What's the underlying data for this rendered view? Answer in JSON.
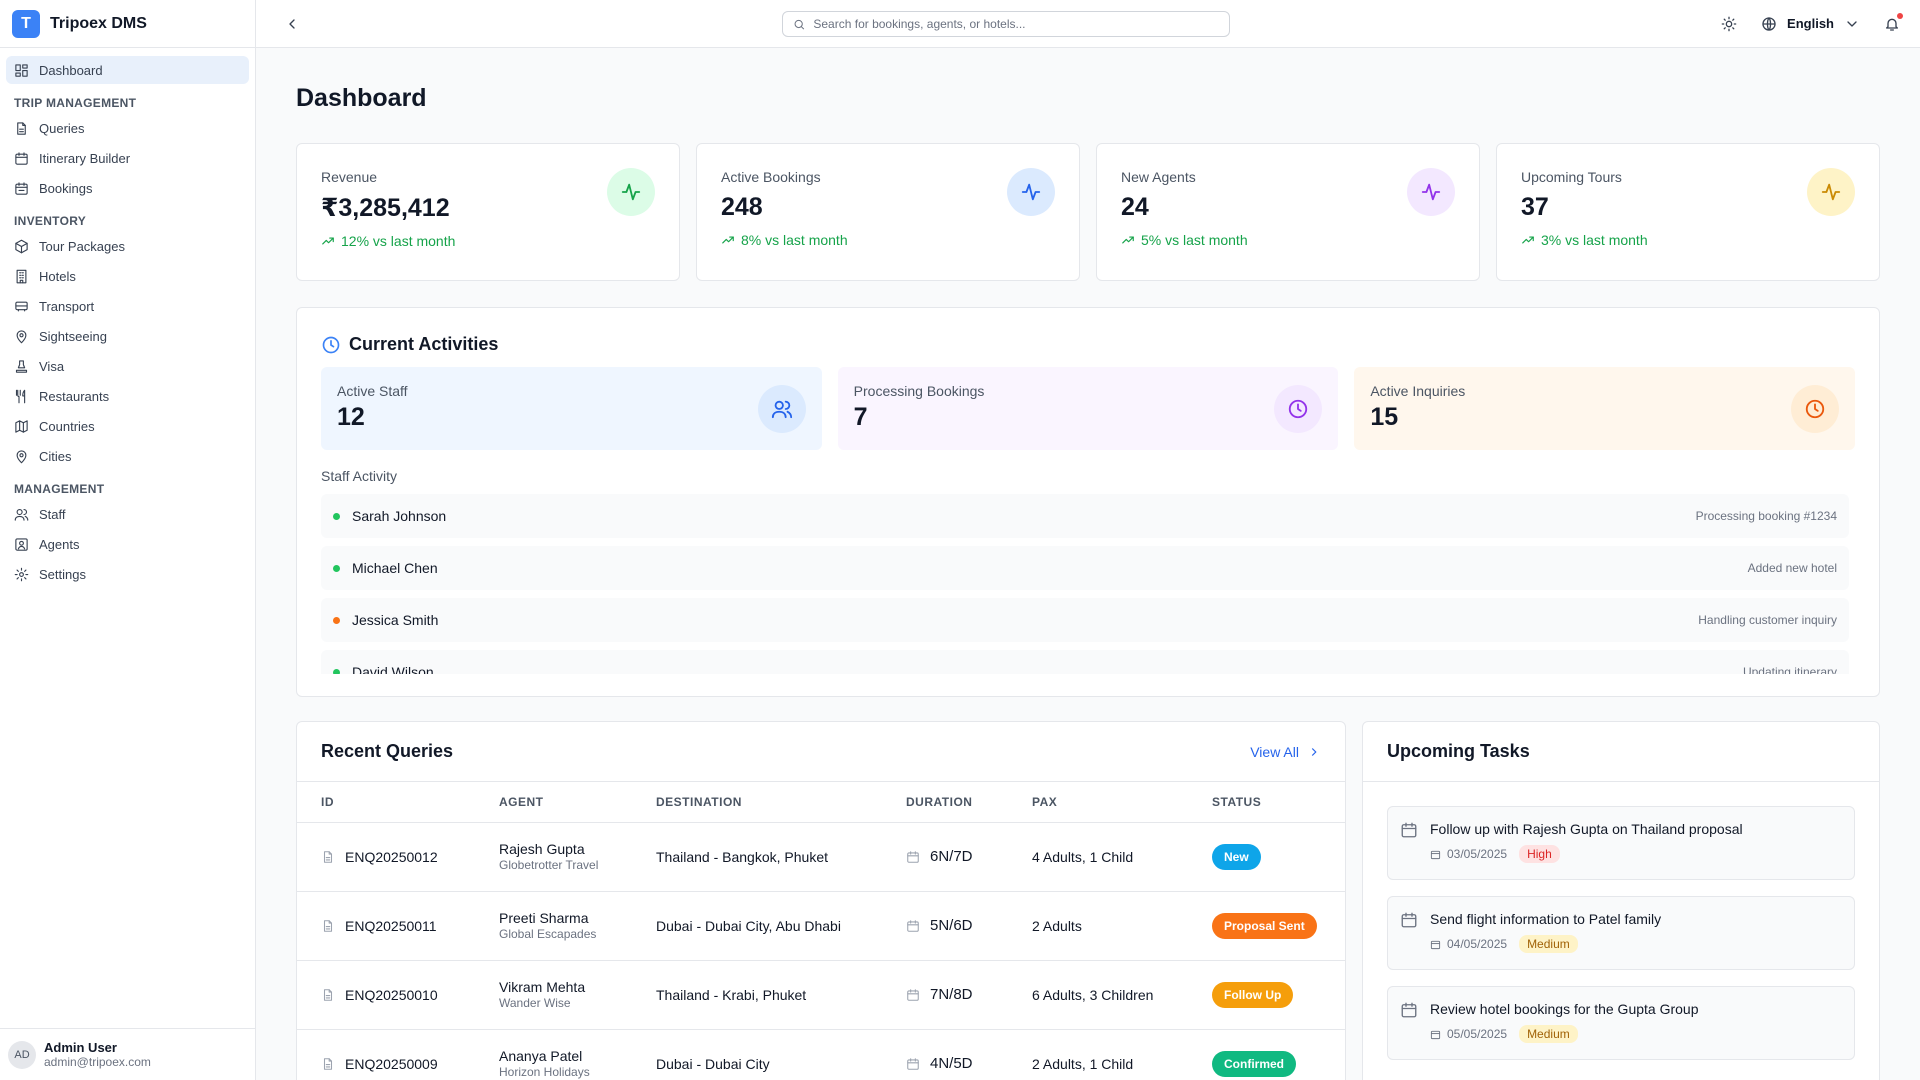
{
  "app": {
    "logo_letter": "T",
    "name": "Tripoex DMS"
  },
  "sidebar": {
    "dashboard": "Dashboard",
    "sections": {
      "trip": "TRIP MANAGEMENT",
      "inventory": "INVENTORY",
      "management": "MANAGEMENT"
    },
    "trip_items": [
      "Queries",
      "Itinerary Builder",
      "Bookings"
    ],
    "inventory_items": [
      "Tour Packages",
      "Hotels",
      "Transport",
      "Sightseeing",
      "Visa",
      "Restaurants",
      "Countries",
      "Cities"
    ],
    "management_items": [
      "Staff",
      "Agents",
      "Settings"
    ]
  },
  "user": {
    "initials": "AD",
    "name": "Admin User",
    "email": "admin@tripoex.com"
  },
  "topbar": {
    "search_placeholder": "Search for bookings, agents, or hotels...",
    "language": "English"
  },
  "page": {
    "title": "Dashboard"
  },
  "stats": [
    {
      "label": "Revenue",
      "value": "₹3,285,412",
      "change": "12% vs last month",
      "color": "#16a34a",
      "bg": "#dcfce7"
    },
    {
      "label": "Active Bookings",
      "value": "248",
      "change": "8% vs last month",
      "color": "#2563eb",
      "bg": "#dbeafe"
    },
    {
      "label": "New Agents",
      "value": "24",
      "change": "5% vs last month",
      "color": "#9333ea",
      "bg": "#f3e8ff"
    },
    {
      "label": "Upcoming Tours",
      "value": "37",
      "change": "3% vs last month",
      "color": "#ca8a04",
      "bg": "#fef3c7"
    }
  ],
  "activities": {
    "title": "Current Activities",
    "cards": [
      {
        "label": "Active Staff",
        "value": "12",
        "bg": "#eff6ff",
        "icon_bg": "#dbeafe",
        "color": "#2563eb"
      },
      {
        "label": "Processing Bookings",
        "value": "7",
        "bg": "#faf5ff",
        "icon_bg": "#f3e8ff",
        "color": "#9333ea"
      },
      {
        "label": "Active Inquiries",
        "value": "15",
        "bg": "#fff7ed",
        "icon_bg": "#ffedd5",
        "color": "#ea580c"
      }
    ],
    "staff_heading": "Staff Activity",
    "staff": [
      {
        "name": "Sarah Johnson",
        "activity": "Processing booking #1234",
        "dot": "#22c55e"
      },
      {
        "name": "Michael Chen",
        "activity": "Added new hotel",
        "dot": "#22c55e"
      },
      {
        "name": "Jessica Smith",
        "activity": "Handling customer inquiry",
        "dot": "#f97316"
      },
      {
        "name": "David Wilson",
        "activity": "Updating itinerary",
        "dot": "#22c55e"
      }
    ]
  },
  "queries": {
    "title": "Recent Queries",
    "view_all": "View All",
    "columns": [
      "ID",
      "AGENT",
      "DESTINATION",
      "DURATION",
      "PAX",
      "STATUS"
    ],
    "rows": [
      {
        "id": "ENQ20250012",
        "agent": "Rajesh Gupta",
        "company": "Globetrotter Travel",
        "destination": "Thailand - Bangkok, Phuket",
        "duration": "6N/7D",
        "pax": "4 Adults, 1 Child",
        "status": "New",
        "status_color": "#0ea5e9"
      },
      {
        "id": "ENQ20250011",
        "agent": "Preeti Sharma",
        "company": "Global Escapades",
        "destination": "Dubai - Dubai City, Abu Dhabi",
        "duration": "5N/6D",
        "pax": "2 Adults",
        "status": "Proposal Sent",
        "status_color": "#f97316"
      },
      {
        "id": "ENQ20250010",
        "agent": "Vikram Mehta",
        "company": "Wander Wise",
        "destination": "Thailand - Krabi, Phuket",
        "duration": "7N/8D",
        "pax": "6 Adults, 3 Children",
        "status": "Follow Up",
        "status_color": "#f59e0b"
      },
      {
        "id": "ENQ20250009",
        "agent": "Ananya Patel",
        "company": "Horizon Holidays",
        "destination": "Dubai - Dubai City",
        "duration": "4N/5D",
        "pax": "2 Adults, 1 Child",
        "status": "Confirmed",
        "status_color": "#10b981"
      }
    ]
  },
  "tasks": {
    "title": "Upcoming Tasks",
    "items": [
      {
        "title": "Follow up with Rajesh Gupta on Thailand proposal",
        "date": "03/05/2025",
        "priority": "High",
        "prio_bg": "#fee2e2",
        "prio_color": "#dc2626"
      },
      {
        "title": "Send flight information to Patel family",
        "date": "04/05/2025",
        "priority": "Medium",
        "prio_bg": "#fef3c7",
        "prio_color": "#a16207"
      },
      {
        "title": "Review hotel bookings for the Gupta Group",
        "date": "05/05/2025",
        "priority": "Medium",
        "prio_bg": "#fef3c7",
        "prio_color": "#a16207"
      }
    ]
  }
}
